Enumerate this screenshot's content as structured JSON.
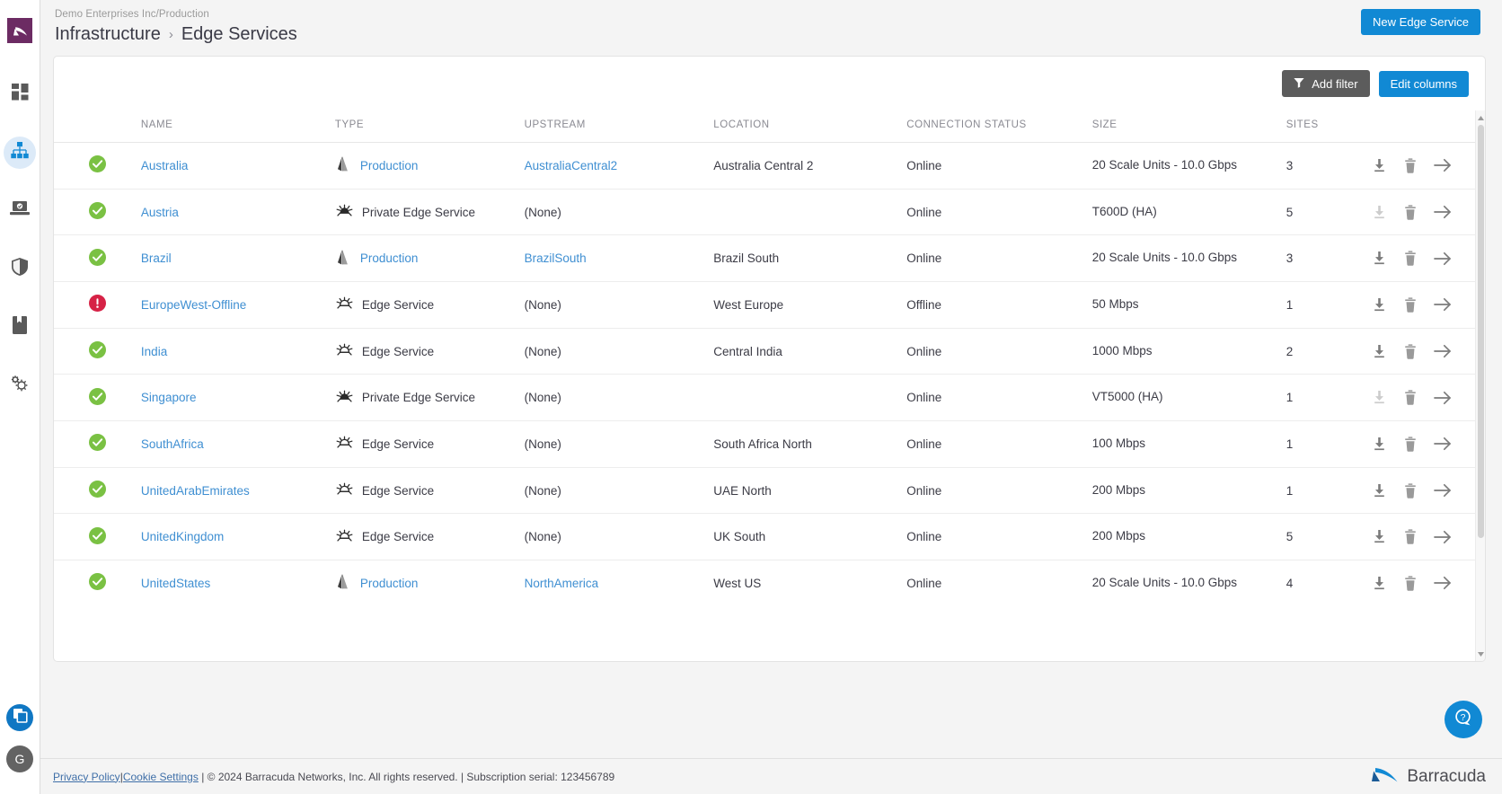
{
  "sidebar": {
    "logo_icon": "barracuda-mark-icon",
    "items": [
      {
        "name": "dashboard",
        "icon": "dashboard-grid-icon",
        "active": false
      },
      {
        "name": "infrastructure",
        "icon": "network-hierarchy-icon",
        "active": true
      },
      {
        "name": "endpoint",
        "icon": "laptop-endpoint-icon",
        "active": false
      },
      {
        "name": "security",
        "icon": "shield-icon",
        "active": false
      },
      {
        "name": "reports",
        "icon": "book-bookmark-icon",
        "active": false
      },
      {
        "name": "settings",
        "icon": "gears-icon",
        "active": false
      }
    ],
    "bottom": [
      {
        "name": "workspaces",
        "icon": "copy-layers-icon"
      },
      {
        "name": "user-avatar",
        "label": "G"
      }
    ]
  },
  "header": {
    "tenant": "Demo Enterprises Inc/Production",
    "breadcrumb": {
      "parent": "Infrastructure",
      "separator": "›",
      "current": "Edge Services"
    },
    "new_button": "New Edge Service"
  },
  "toolbar": {
    "add_filter": "Add filter",
    "filter_icon": "funnel-icon",
    "edit_columns": "Edit columns"
  },
  "table": {
    "columns": [
      "",
      "NAME",
      "TYPE",
      "UPSTREAM",
      "LOCATION",
      "CONNECTION STATUS",
      "SIZE",
      "SITES",
      ""
    ],
    "rows": [
      {
        "status": "ok",
        "name": "Australia",
        "type": "Production",
        "type_icon": "azure-icon",
        "type_link": true,
        "upstream": "AustraliaCentral2",
        "upstream_link": true,
        "location": "Australia Central 2",
        "connection": "Online",
        "size": "20 Scale Units - 10.0 Gbps",
        "sites": "3",
        "download_enabled": true
      },
      {
        "status": "ok",
        "name": "Austria",
        "type": "Private Edge Service",
        "type_icon": "private-edge-icon",
        "type_link": false,
        "upstream": "(None)",
        "upstream_link": false,
        "location": "",
        "connection": "Online",
        "size": "T600D (HA)",
        "sites": "5",
        "download_enabled": false
      },
      {
        "status": "ok",
        "name": "Brazil",
        "type": "Production",
        "type_icon": "azure-icon",
        "type_link": true,
        "upstream": "BrazilSouth",
        "upstream_link": true,
        "location": "Brazil South",
        "connection": "Online",
        "size": "20 Scale Units - 10.0 Gbps",
        "sites": "3",
        "download_enabled": true
      },
      {
        "status": "error",
        "name": "EuropeWest-Offline",
        "type": "Edge Service",
        "type_icon": "edge-service-icon",
        "type_link": false,
        "upstream": "(None)",
        "upstream_link": false,
        "location": "West Europe",
        "connection": "Offline",
        "size": "50 Mbps",
        "sites": "1",
        "download_enabled": true
      },
      {
        "status": "ok",
        "name": "India",
        "type": "Edge Service",
        "type_icon": "edge-service-icon",
        "type_link": false,
        "upstream": "(None)",
        "upstream_link": false,
        "location": "Central India",
        "connection": "Online",
        "size": "1000 Mbps",
        "sites": "2",
        "download_enabled": true
      },
      {
        "status": "ok",
        "name": "Singapore",
        "type": "Private Edge Service",
        "type_icon": "private-edge-icon",
        "type_link": false,
        "upstream": "(None)",
        "upstream_link": false,
        "location": "",
        "connection": "Online",
        "size": "VT5000 (HA)",
        "sites": "1",
        "download_enabled": false
      },
      {
        "status": "ok",
        "name": "SouthAfrica",
        "type": "Edge Service",
        "type_icon": "edge-service-icon",
        "type_link": false,
        "upstream": "(None)",
        "upstream_link": false,
        "location": "South Africa North",
        "connection": "Online",
        "size": "100 Mbps",
        "sites": "1",
        "download_enabled": true
      },
      {
        "status": "ok",
        "name": "UnitedArabEmirates",
        "type": "Edge Service",
        "type_icon": "edge-service-icon",
        "type_link": false,
        "upstream": "(None)",
        "upstream_link": false,
        "location": "UAE North",
        "connection": "Online",
        "size": "200 Mbps",
        "sites": "1",
        "download_enabled": true
      },
      {
        "status": "ok",
        "name": "UnitedKingdom",
        "type": "Edge Service",
        "type_icon": "edge-service-icon",
        "type_link": false,
        "upstream": "(None)",
        "upstream_link": false,
        "location": "UK South",
        "connection": "Online",
        "size": "200 Mbps",
        "sites": "5",
        "download_enabled": true
      },
      {
        "status": "ok",
        "name": "UnitedStates",
        "type": "Production",
        "type_icon": "azure-icon",
        "type_link": true,
        "upstream": "NorthAmerica",
        "upstream_link": true,
        "location": "West US",
        "connection": "Online",
        "size": "20 Scale Units - 10.0 Gbps",
        "sites": "4",
        "download_enabled": true
      }
    ],
    "row_actions": [
      "download-icon",
      "delete-icon",
      "open-arrow-icon"
    ]
  },
  "help": {
    "icon": "question-bubble-icon"
  },
  "footer": {
    "privacy": "Privacy Policy",
    "sep1": "|",
    "cookies": "Cookie Settings",
    "rest": "| © 2024 Barracuda Networks, Inc. All rights reserved. | Subscription serial: 123456789",
    "brand": "Barracuda"
  },
  "colors": {
    "accent_blue": "#1189d4",
    "link_blue": "#3f8fd2",
    "status_ok": "#7ac143",
    "status_error": "#d62246",
    "logo_purple": "#6c2b63",
    "grey_button": "#5c5c5c"
  }
}
